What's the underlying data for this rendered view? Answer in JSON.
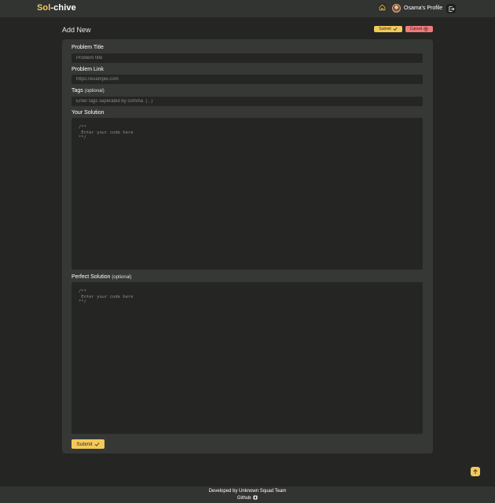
{
  "header": {
    "logo_accent": "Sol",
    "logo_rest": "-chive",
    "profile_name": "Osama's Profile"
  },
  "page": {
    "title": "Add New",
    "submit_label": "Submit",
    "cancel_label": "Cancel"
  },
  "form": {
    "problem_title": {
      "label": "Problem Title",
      "placeholder": "Problem title",
      "value": ""
    },
    "problem_link": {
      "label": "Problem Link",
      "placeholder": "https://example.com",
      "value": ""
    },
    "tags": {
      "label": "Tags",
      "optional": "(optional)",
      "placeholder": "Enter tags seperated by comma  ( , )",
      "value": ""
    },
    "your_solution": {
      "label": "Your Solution",
      "placeholder": "/**\n Enter your code here\n**/"
    },
    "perfect_solution": {
      "label": "Perfect Solution",
      "optional": "(optional)",
      "placeholder": "/**\n Enter your code here\n**/"
    },
    "submit_label": "Submit"
  },
  "footer": {
    "credit": "Developed by Unknown Squad Team",
    "github": "Github"
  },
  "icons": {
    "home": "home-icon",
    "logout": "logout-icon",
    "check": "check-icon",
    "cancel": "x-circle-icon",
    "arrow_up": "arrow-up-icon",
    "github": "github-icon"
  },
  "colors": {
    "accent": "#f3c95a",
    "danger": "#f07a7a",
    "background": "#252624",
    "card": "#363835",
    "bar": "#323432"
  }
}
